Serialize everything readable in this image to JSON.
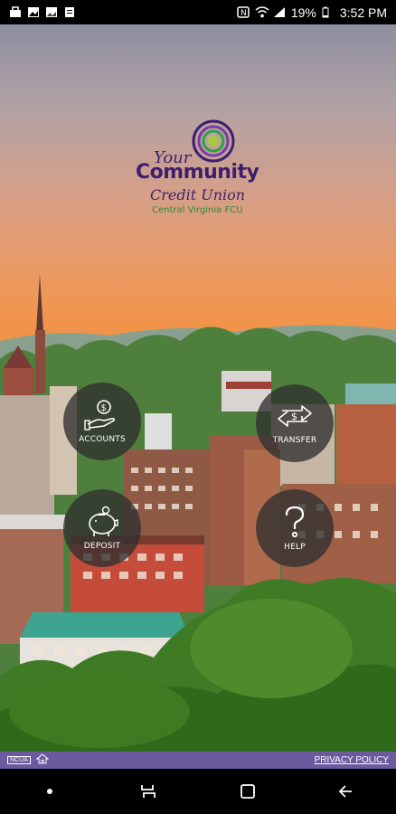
{
  "status_bar": {
    "battery": "19%",
    "time": "3:52 PM",
    "icons": [
      "bag-icon",
      "image-icon",
      "photo-icon",
      "doc-icon",
      "nfc-icon",
      "wifi-icon",
      "signal-icon",
      "battery-icon"
    ]
  },
  "logo": {
    "line1": "Your",
    "line2": "Community",
    "line3": "Credit Union",
    "tagline": "Central Virginia FCU"
  },
  "actions": [
    {
      "label": "ACCOUNTS",
      "icon": "hand-money-icon"
    },
    {
      "label": "TRANSFER",
      "icon": "transfer-icon"
    },
    {
      "label": "DEPOSIT",
      "icon": "piggy-bank-icon"
    },
    {
      "label": "HELP",
      "icon": "question-icon"
    }
  ],
  "footer": {
    "ncua": "NCUA",
    "privacy": "PRIVACY POLICY"
  },
  "colors": {
    "brand_purple": "#3e1f6d",
    "footer_purple": "#6b5b9e",
    "tagline_green": "#2a8a3a"
  }
}
